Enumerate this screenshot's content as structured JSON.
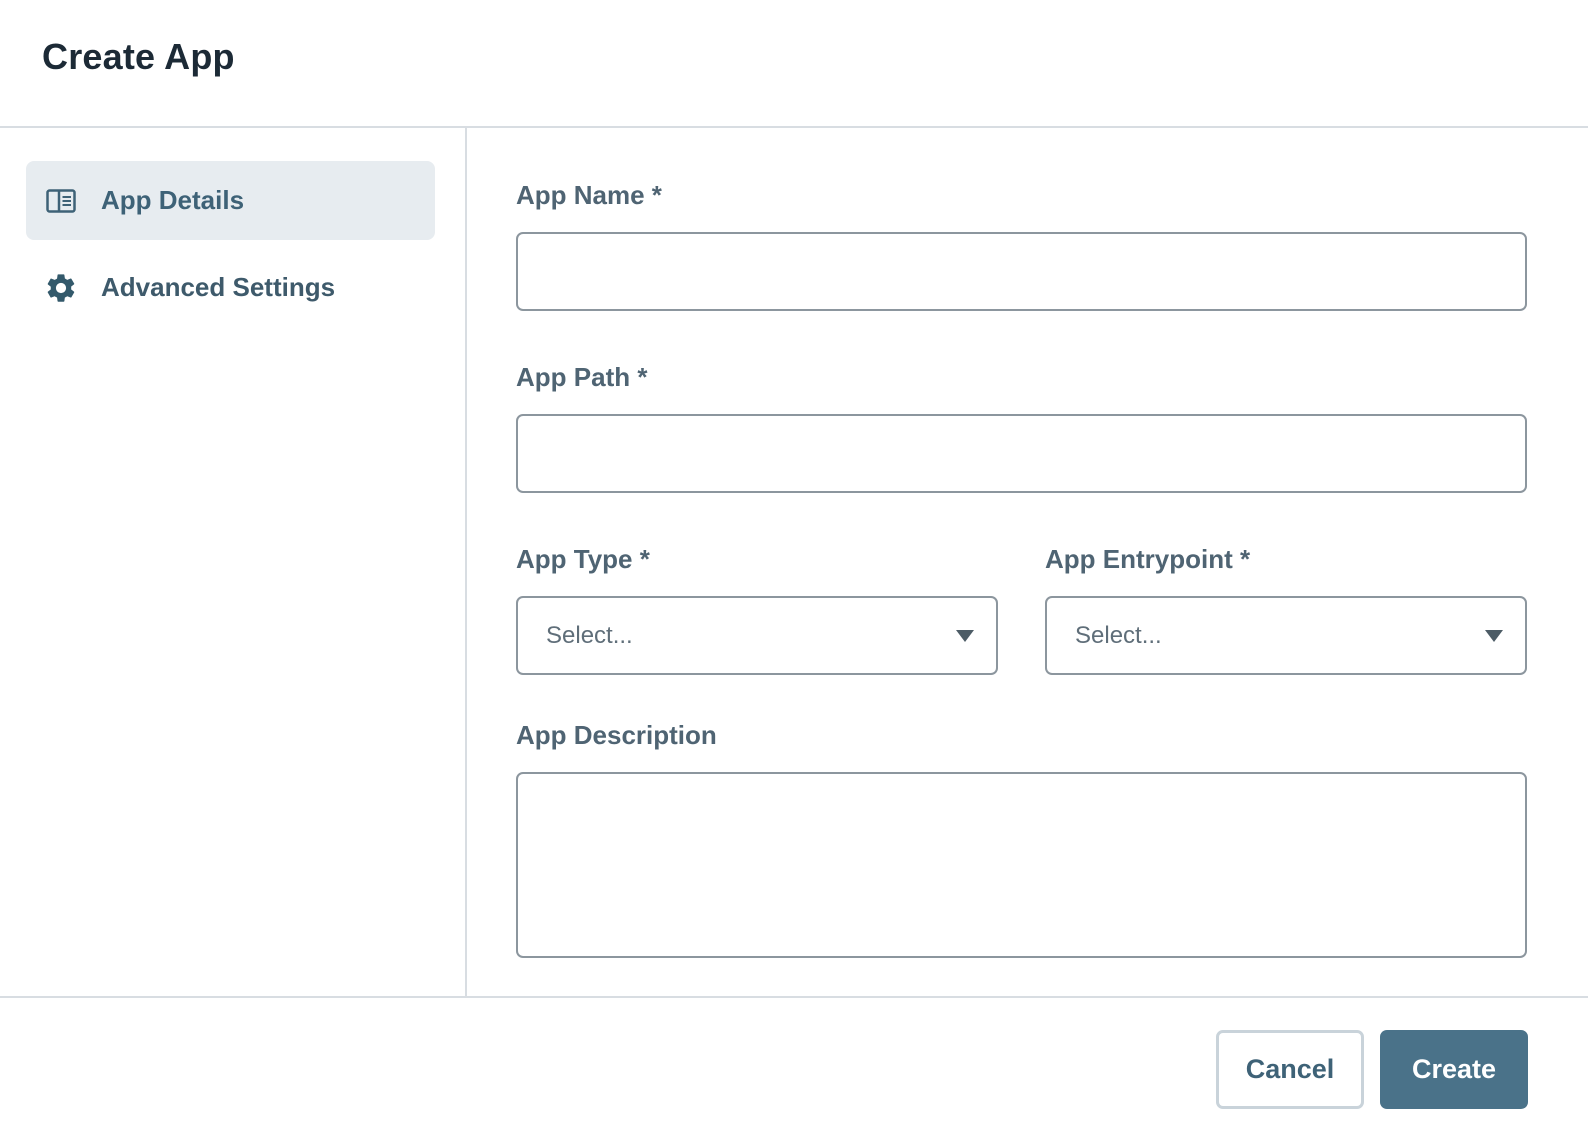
{
  "dialog": {
    "title": "Create App"
  },
  "sidebar": {
    "items": [
      {
        "label": "App Details",
        "icon": "panel-details-icon",
        "active": true
      },
      {
        "label": "Advanced Settings",
        "icon": "gear-icon",
        "active": false
      }
    ]
  },
  "form": {
    "app_name": {
      "label": "App Name *",
      "value": "",
      "placeholder": ""
    },
    "app_path": {
      "label": "App Path *",
      "value": "",
      "placeholder": ""
    },
    "app_type": {
      "label": "App Type *",
      "selected": "Select..."
    },
    "app_entrypoint": {
      "label": "App Entrypoint *",
      "selected": "Select..."
    },
    "app_description": {
      "label": "App Description",
      "value": ""
    }
  },
  "footer": {
    "cancel_label": "Cancel",
    "create_label": "Create"
  },
  "colors": {
    "primary": "#4a7289",
    "active_nav_bg": "#e7ecf0",
    "border": "#8c969e",
    "divider": "#d8dde2"
  }
}
